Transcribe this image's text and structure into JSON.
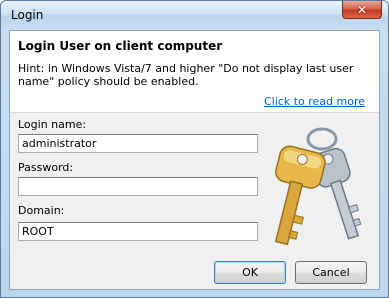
{
  "window": {
    "title": "Login",
    "close_glyph": "✕"
  },
  "header": {
    "title": "Login User on client computer",
    "hint": "Hint: in Windows Vista/7 and higher  \"Do not display last user name\" policy should be enabled.",
    "read_more_link": "Click to read more"
  },
  "form": {
    "login_label": "Login name:",
    "login_value": "administrator",
    "password_label": "Password:",
    "password_value": "",
    "domain_label": "Domain:",
    "domain_value": "ROOT"
  },
  "buttons": {
    "ok": "OK",
    "cancel": "Cancel"
  },
  "icons": {
    "close": "close-icon",
    "keys": "keys-icon"
  },
  "colors": {
    "link": "#0066cc",
    "close_button": "#c0391e",
    "key_gold": "#e8b84a",
    "key_silver": "#b9c3cc"
  }
}
